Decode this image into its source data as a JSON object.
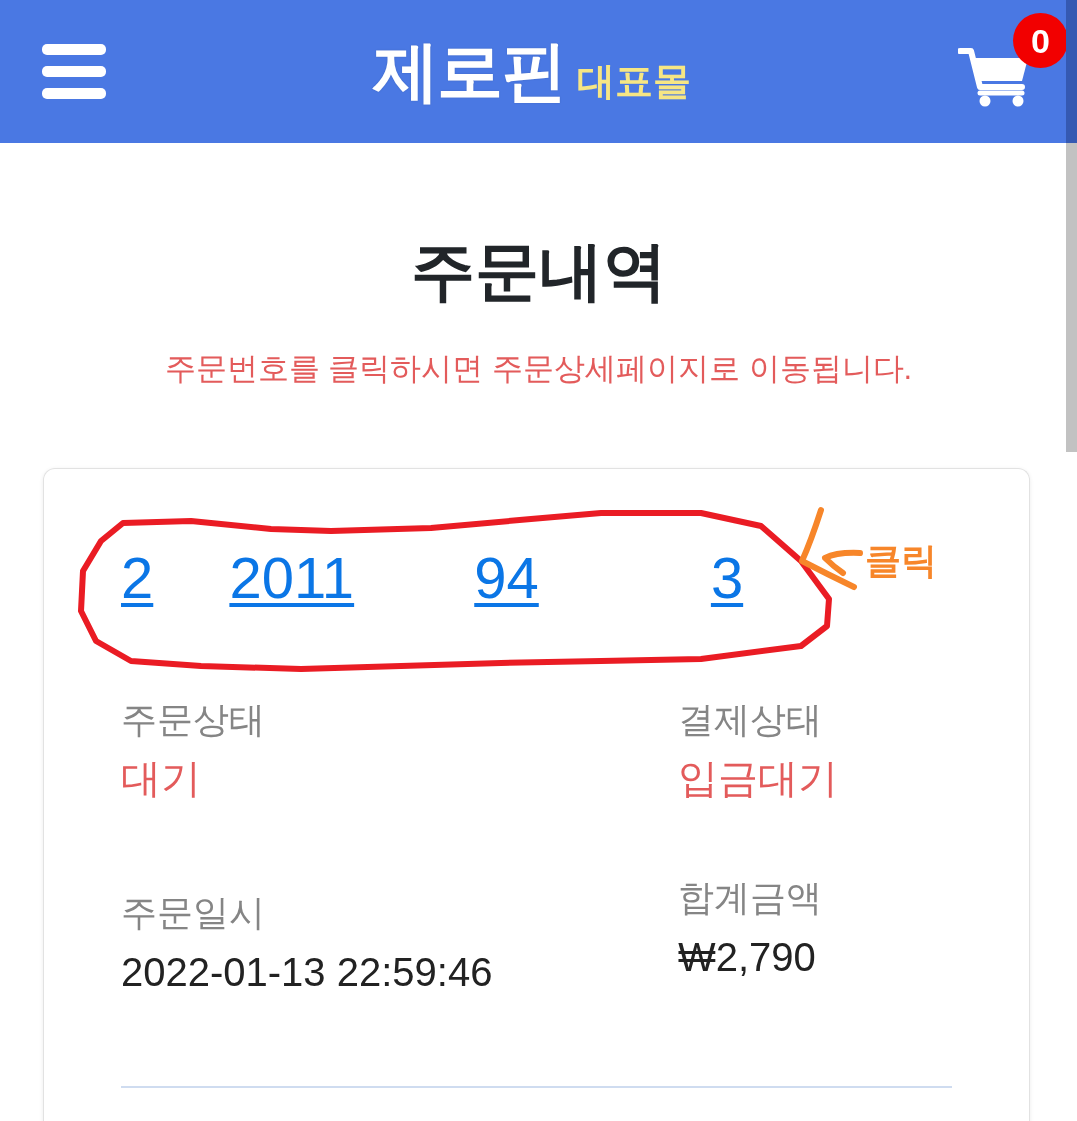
{
  "header": {
    "logo_main": "제로핀",
    "logo_sub": "대표몰",
    "cart_count": "0"
  },
  "page": {
    "title": "주문내역",
    "notice": "주문번호를 클릭하시면 주문상세페이지로 이동됩니다."
  },
  "order": {
    "order_number_parts": [
      "2",
      "2011",
      "94",
      "3"
    ],
    "annotation": {
      "label": "클릭"
    },
    "fields": [
      {
        "label": "주문상태",
        "value": "대기",
        "kind": "status"
      },
      {
        "label": "결제상태",
        "value": "입금대기",
        "kind": "status"
      },
      {
        "label": "주문일시",
        "value": "2022-01-13 22:59:46",
        "kind": "plain"
      },
      {
        "label": "합계금액",
        "value": "₩2,790",
        "kind": "plain"
      }
    ]
  }
}
